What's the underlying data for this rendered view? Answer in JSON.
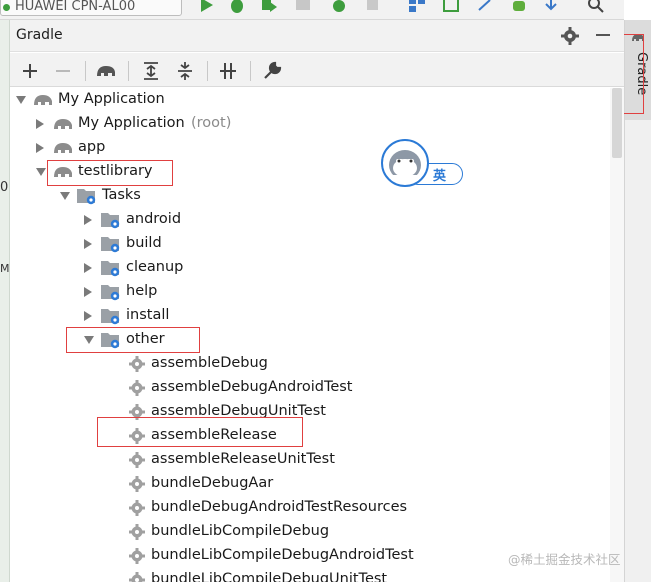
{
  "topbar": {
    "device_label": "HUAWEI CPN-AL00"
  },
  "left_strip": {
    "chars": [
      "0",
      "Ma"
    ]
  },
  "stripe": {
    "gradle_label": "Gradle"
  },
  "panel": {
    "title": "Gradle"
  },
  "toolbar": {
    "buttons": [
      {
        "icon": "plus-icon"
      },
      {
        "icon": "minus-icon"
      },
      {
        "icon": "elephant-icon"
      },
      {
        "icon": "expand-all-icon"
      },
      {
        "icon": "collapse-all-icon"
      },
      {
        "icon": "toggle-offline-icon"
      },
      {
        "icon": "wrench-icon"
      }
    ]
  },
  "tree": {
    "root": "My Application",
    "root_project": "My Application",
    "root_project_suffix": "(root)",
    "app": "app",
    "testlibrary": "testlibrary",
    "tasks": "Tasks",
    "groups": [
      "android",
      "build",
      "cleanup",
      "help",
      "install",
      "other"
    ],
    "other_tasks": [
      "assembleDebug",
      "assembleDebugAndroidTest",
      "assembleDebugUnitTest",
      "assembleRelease",
      "assembleReleaseUnitTest",
      "bundleDebugAar",
      "bundleDebugAndroidTestResources",
      "bundleLibCompileDebug",
      "bundleLibCompileDebugAndroidTest",
      "bundleLibCompileDebugUnitTest"
    ]
  },
  "ime": {
    "label": "英"
  },
  "watermark": "@稀土掘金技术社区",
  "colors": {
    "highlight": "#e04040",
    "ime_blue": "#2b7ad6",
    "gear_blue": "#2e7bd6"
  }
}
